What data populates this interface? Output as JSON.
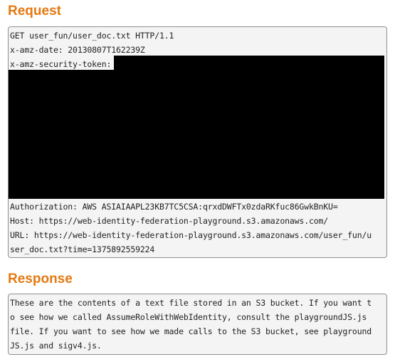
{
  "request": {
    "title": "Request",
    "lines": [
      "GET user_fun/user_doc.txt HTTP/1.1",
      "x-amz-date: 20130807T162239Z",
      "x-amz-security-token:",
      "Authorization: AWS ASIAIAAPL23KB7TC5CSA:qrxdDWFTx0zdaRKfuc86GwkBnKU=",
      "Host: https://web-identity-federation-playground.s3.amazonaws.com/",
      "URL: https://web-identity-federation-playground.s3.amazonaws.com/user_fun/u",
      "ser_doc.txt?time=1375892559224"
    ],
    "redacted": "security token value (redacted black block)"
  },
  "response": {
    "title": "Response",
    "lines": [
      "These are the contents of a text file stored in an S3 bucket. If you want t",
      "o see how we called AssumeRoleWithWebIdentity, consult the playgroundJS.js",
      "file. If you want to see how we made calls to the S3 bucket, see playground",
      "JS.js and sigv4.js."
    ]
  }
}
